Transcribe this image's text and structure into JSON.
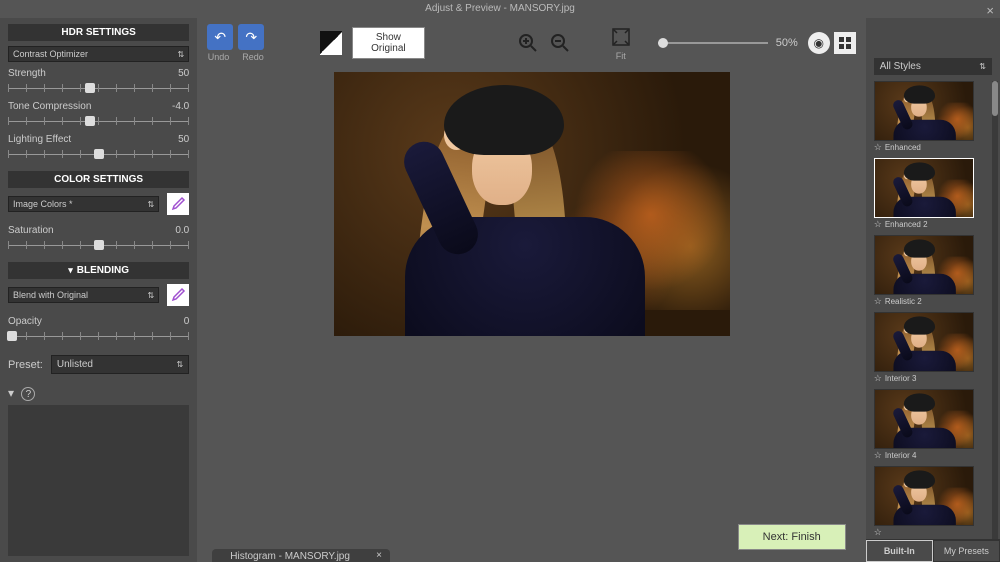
{
  "title": "Adjust & Preview - MANSORY.jpg",
  "hdr": {
    "header": "HDR SETTINGS",
    "mode": "Contrast Optimizer",
    "sliders": [
      {
        "label": "Strength",
        "value": "50",
        "pos": 45
      },
      {
        "label": "Tone Compression",
        "value": "-4.0",
        "pos": 45
      },
      {
        "label": "Lighting Effect",
        "value": "50",
        "pos": 50
      }
    ]
  },
  "color": {
    "header": "COLOR SETTINGS",
    "mode": "Image Colors *",
    "slider": {
      "label": "Saturation",
      "value": "0.0",
      "pos": 50
    }
  },
  "blending": {
    "header": "BLENDING",
    "mode": "Blend with Original",
    "slider": {
      "label": "Opacity",
      "value": "0",
      "pos": 2
    }
  },
  "preset": {
    "label": "Preset:",
    "value": "Unlisted"
  },
  "toolbar": {
    "undo": "Undo",
    "redo": "Redo",
    "show_original": "Show Original",
    "fit": "Fit",
    "zoom": "50%"
  },
  "next_button": "Next: Finish",
  "histogram_tab": "Histogram - MANSORY.jpg",
  "styles": {
    "dropdown": "All Styles",
    "items": [
      {
        "label": "Enhanced",
        "selected": false,
        "hue": 0,
        "bright": 1
      },
      {
        "label": "Enhanced 2",
        "selected": true,
        "hue": 10,
        "bright": 1.1
      },
      {
        "label": "Realistic 2",
        "selected": false,
        "hue": 15,
        "bright": 1.15
      },
      {
        "label": "Interior 3",
        "selected": false,
        "hue": 20,
        "bright": 1.25
      },
      {
        "label": "Interior 4",
        "selected": false,
        "hue": 25,
        "bright": 1.3
      },
      {
        "label": "",
        "selected": false,
        "hue": 30,
        "bright": 1.4
      }
    ],
    "tabs": {
      "builtin": "Built-In",
      "my": "My Presets"
    }
  }
}
